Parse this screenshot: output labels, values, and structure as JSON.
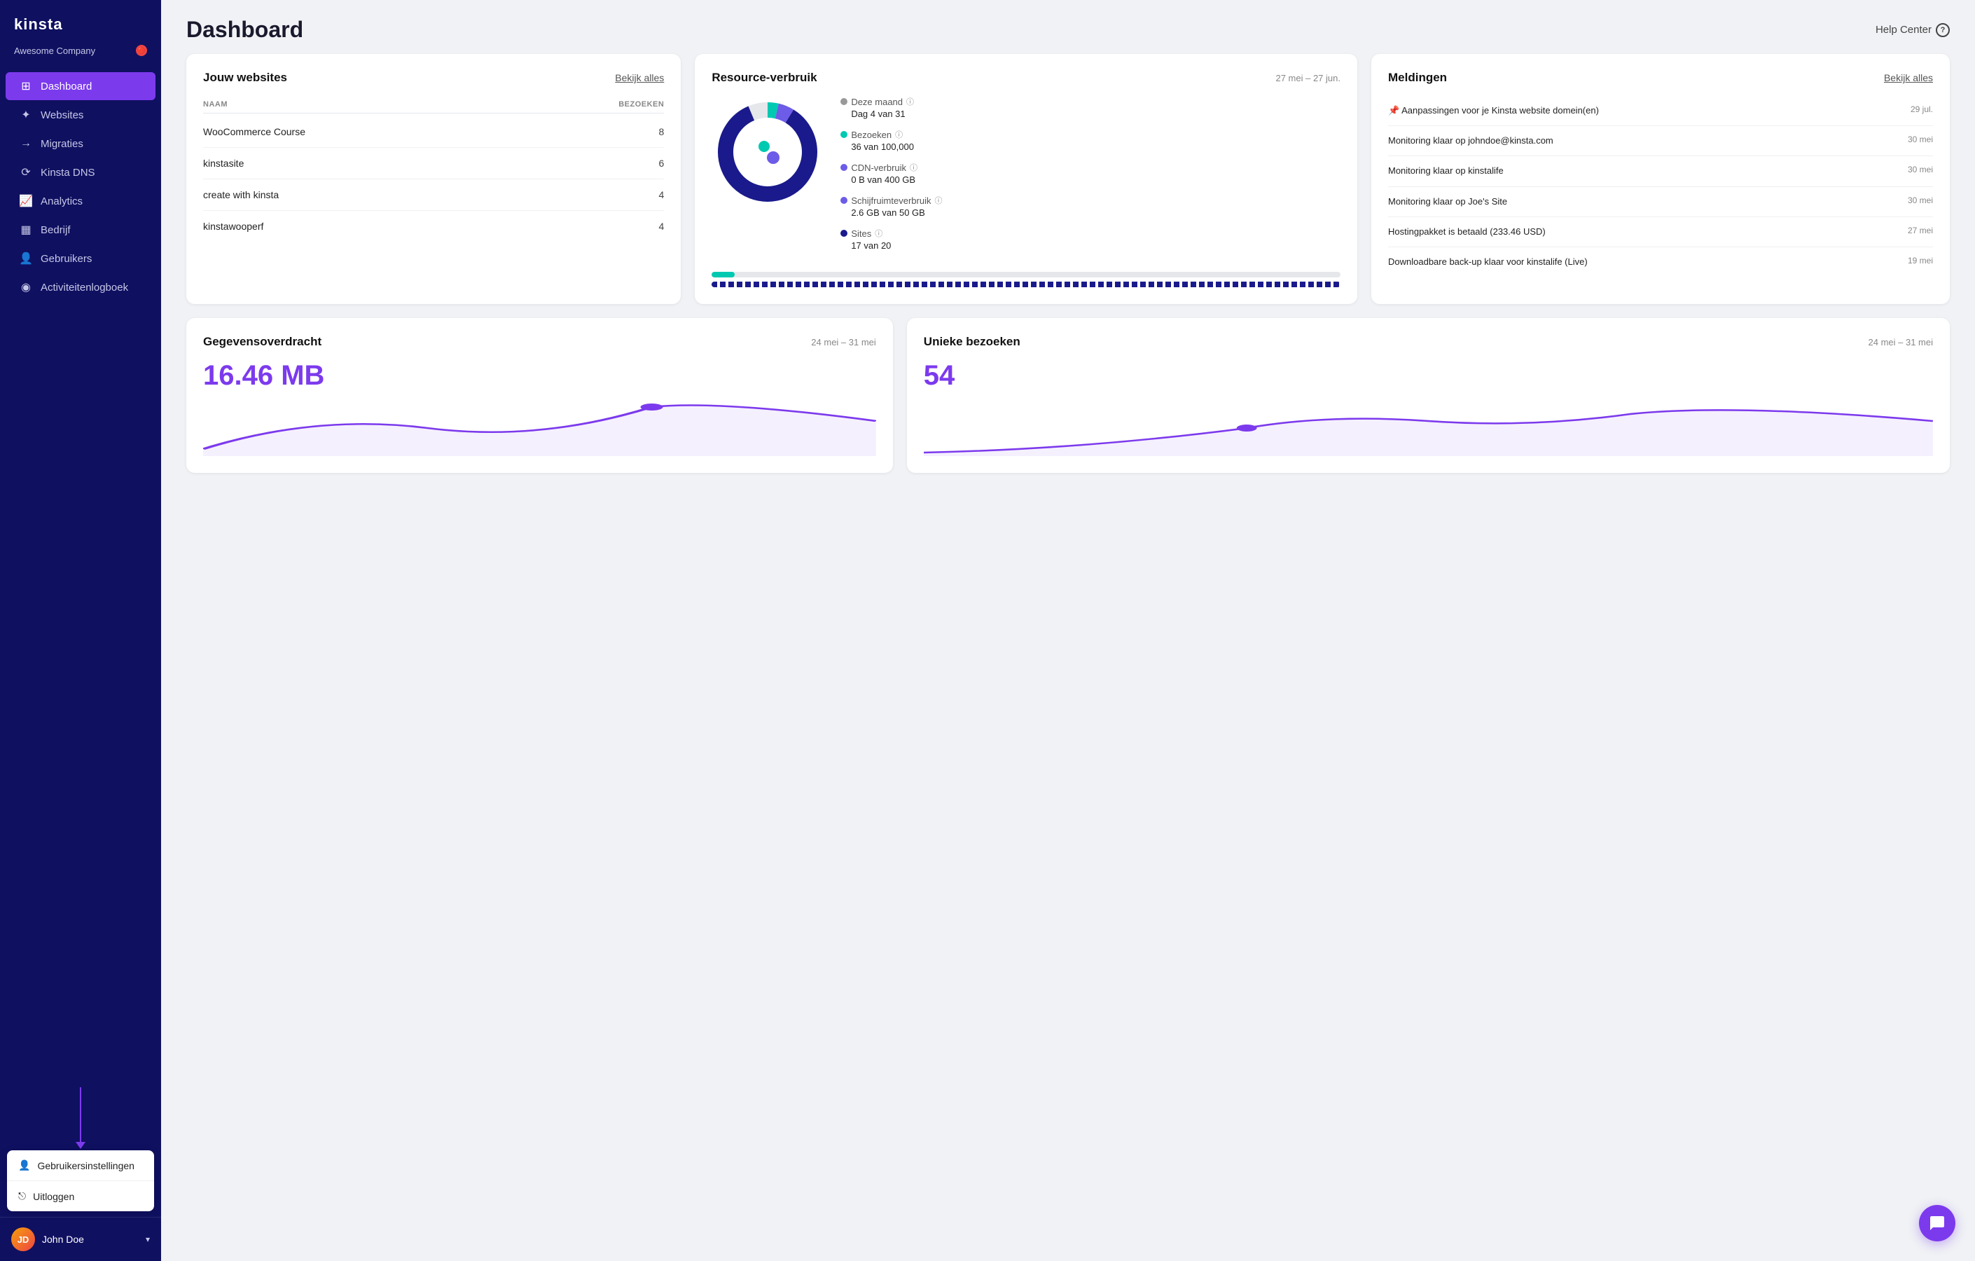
{
  "app": {
    "logo": "kinsta",
    "company": "Awesome Company"
  },
  "header": {
    "title": "Dashboard",
    "help_center": "Help Center"
  },
  "sidebar": {
    "nav_items": [
      {
        "id": "dashboard",
        "label": "Dashboard",
        "active": true
      },
      {
        "id": "websites",
        "label": "Websites",
        "active": false
      },
      {
        "id": "migrations",
        "label": "Migraties",
        "active": false
      },
      {
        "id": "dns",
        "label": "Kinsta DNS",
        "active": false
      },
      {
        "id": "analytics",
        "label": "Analytics",
        "active": false
      },
      {
        "id": "company",
        "label": "Bedrijf",
        "active": false
      },
      {
        "id": "users",
        "label": "Gebruikers",
        "active": false
      },
      {
        "id": "activity",
        "label": "Activiteitenlogboek",
        "active": false
      }
    ],
    "popup": {
      "settings_label": "Gebruikersinstellingen",
      "logout_label": "Uitloggen"
    },
    "user": {
      "name": "John Doe"
    }
  },
  "websites_card": {
    "title": "Jouw websites",
    "link": "Bekijk alles",
    "col_name": "NAAM",
    "col_visits": "BEZOEKEN",
    "sites": [
      {
        "name": "WooCommerce Course",
        "visits": 8
      },
      {
        "name": "kinstasite",
        "visits": 6
      },
      {
        "name": "create with kinsta",
        "visits": 4
      },
      {
        "name": "kinstawooperf",
        "visits": 4
      }
    ]
  },
  "resources_card": {
    "title": "Resource-verbruik",
    "date_range": "27 mei – 27 jun.",
    "this_month_label": "Deze maand",
    "this_month_value": "Dag 4 van 31",
    "visits_label": "Bezoeken",
    "visits_value": "36 van 100,000",
    "cdn_label": "CDN-verbruik",
    "cdn_value": "0 B van 400 GB",
    "disk_label": "Schijfruimteverbruik",
    "disk_value": "2.6 GB van 50 GB",
    "sites_label": "Sites",
    "sites_value": "17 van 20",
    "donut": {
      "visits_pct": 0.036,
      "cdn_pct": 0,
      "disk_pct": 0.052,
      "sites_pct": 0.85,
      "colors": [
        "#00c9b1",
        "#6c5ce7",
        "#1a1a8c",
        "#e0e0e0"
      ]
    }
  },
  "notifications_card": {
    "title": "Meldingen",
    "link": "Bekijk alles",
    "items": [
      {
        "text": "Aanpassingen voor je Kinsta website domein(en)",
        "date": "29 jul.",
        "pinned": true
      },
      {
        "text": "Monitoring klaar op johndoe@kinsta.com",
        "date": "30 mei",
        "pinned": false
      },
      {
        "text": "Monitoring klaar op kinstalife",
        "date": "30 mei",
        "pinned": false
      },
      {
        "text": "Monitoring klaar op Joe's Site",
        "date": "30 mei",
        "pinned": false
      },
      {
        "text": "Hostingpakket is betaald (233.46 USD)",
        "date": "27 mei",
        "pinned": false
      },
      {
        "text": "Downloadbare back-up klaar voor kinstalife (Live)",
        "date": "19 mei",
        "pinned": false
      }
    ]
  },
  "transfer_card": {
    "title": "Gegevensoverdracht",
    "date_range": "24 mei – 31 mei",
    "value": "16.46 MB"
  },
  "visits_card": {
    "title": "Unieke bezoeken",
    "date_range": "24 mei – 31 mei",
    "value": "54"
  },
  "colors": {
    "primary": "#7c3aed",
    "sidebar_bg": "#0f1060",
    "teal": "#00c9b1",
    "dark_blue": "#1a1a8c"
  }
}
